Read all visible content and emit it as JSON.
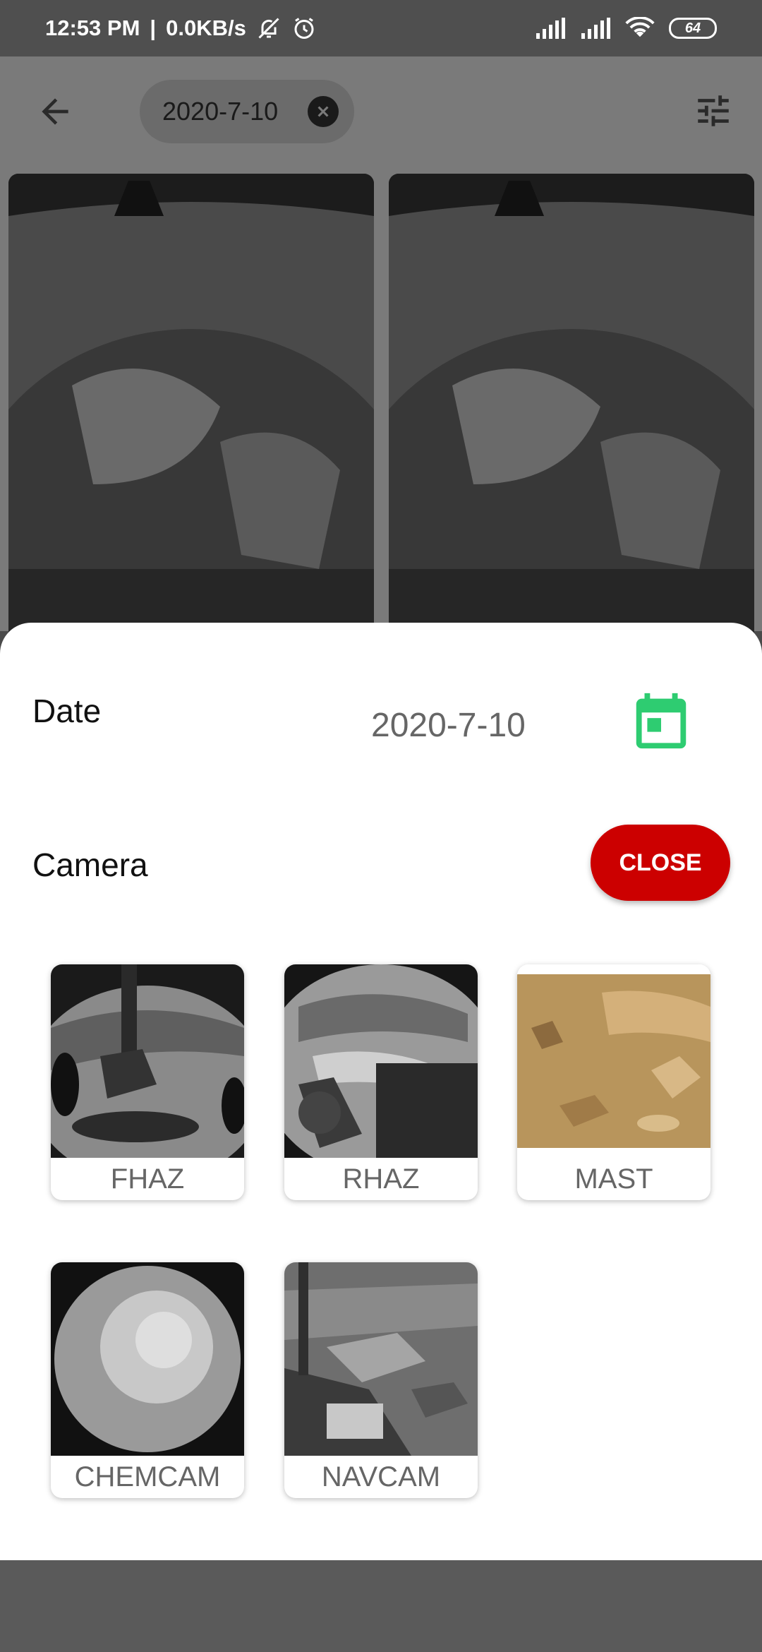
{
  "status_bar": {
    "time": "12:53 PM",
    "separator": "|",
    "network_speed": "0.0KB/s",
    "battery": "64"
  },
  "app_bar": {
    "back_icon": "arrow-back-icon",
    "filter_chip_label": "2020-7-10",
    "chip_close_icon": "cancel-icon",
    "tune_icon": "tune-icon"
  },
  "sheet": {
    "date_label": "Date",
    "date_value": "2020-7-10",
    "calendar_icon": "calendar-icon",
    "camera_label": "Camera",
    "close_button": "CLOSE",
    "cameras": [
      {
        "name": "FHAZ"
      },
      {
        "name": "RHAZ"
      },
      {
        "name": "MAST"
      },
      {
        "name": "CHEMCAM"
      },
      {
        "name": "NAVCAM"
      }
    ]
  },
  "colors": {
    "accent_green": "#2ecc71",
    "close_red": "#cc0000",
    "scrim": "#7a7a7a"
  }
}
